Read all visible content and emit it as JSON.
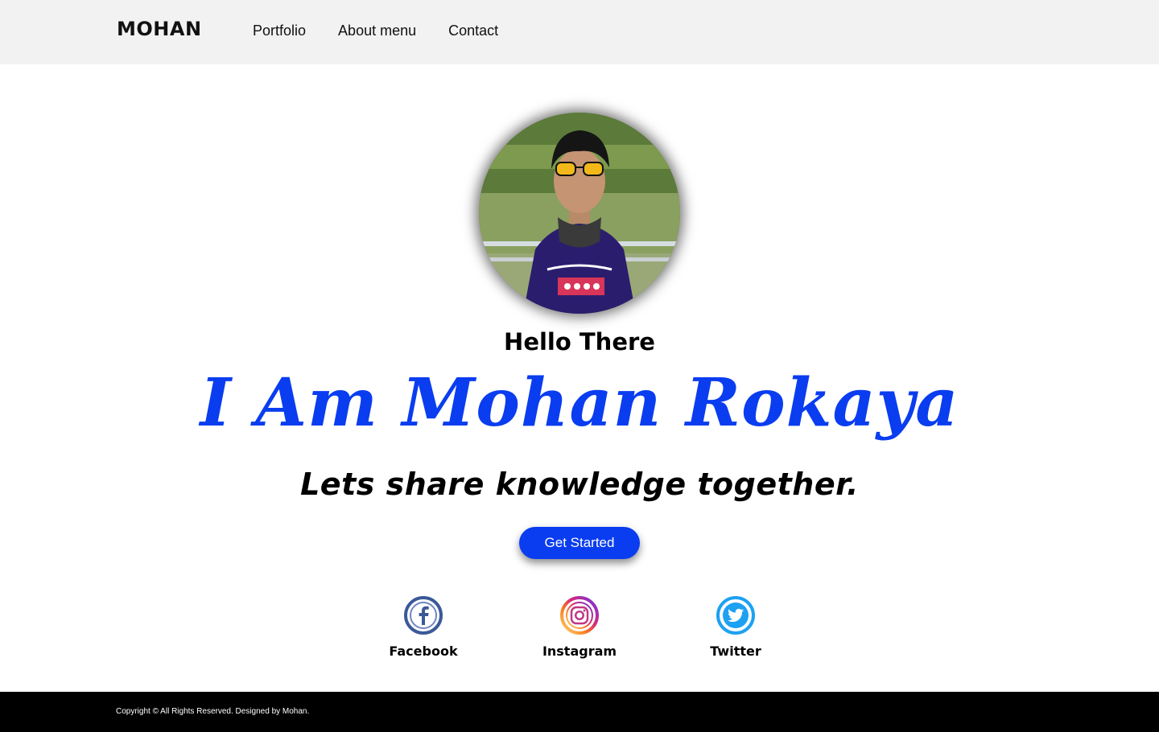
{
  "header": {
    "brand": "MOHAN",
    "nav": [
      "Portfolio",
      "About menu",
      "Contact"
    ]
  },
  "hero": {
    "avatar_icon": "profile-photo",
    "greeting": "Hello There",
    "name": "I Am Mohan Rokaya",
    "tagline": "Lets share knowledge together.",
    "cta_label": "Get Started",
    "accent_color": "#0a3df0"
  },
  "socials": [
    {
      "label": "Facebook",
      "icon": "facebook-icon",
      "color": "#3b5998"
    },
    {
      "label": "Instagram",
      "icon": "instagram-icon",
      "color": "#c13584"
    },
    {
      "label": "Twitter",
      "icon": "twitter-icon",
      "color": "#1da1f2"
    }
  ],
  "footer": {
    "copyright": "Copyright © All Rights Reserved. Designed by Mohan."
  }
}
